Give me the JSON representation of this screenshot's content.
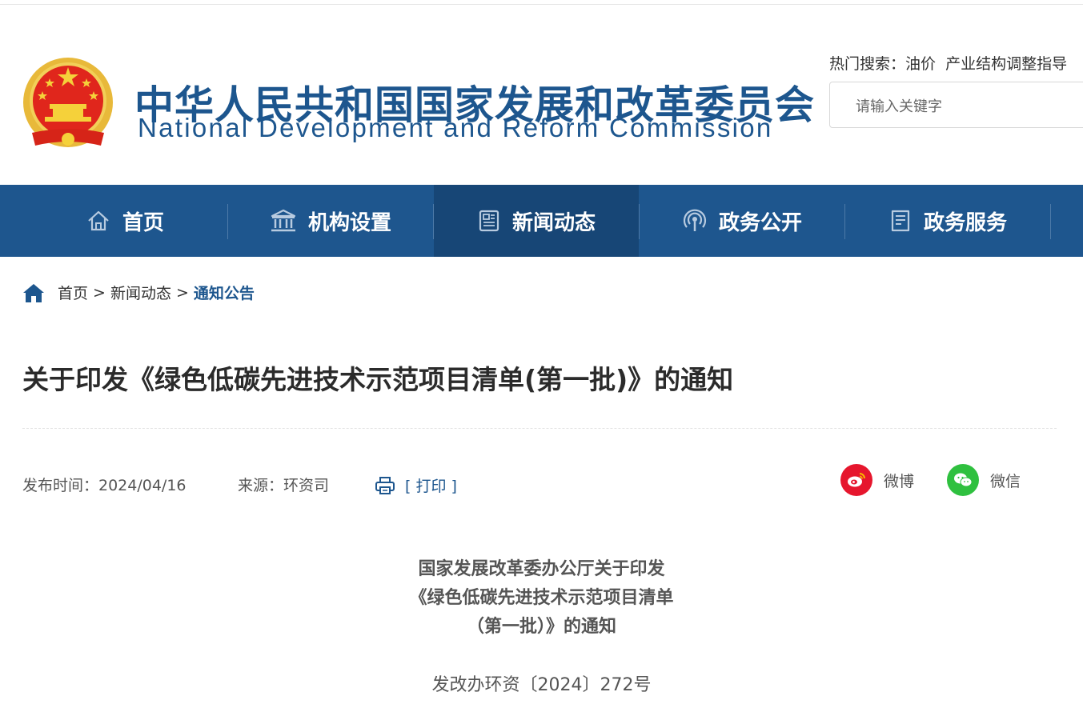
{
  "header": {
    "logo_cn": "中华人民共和国国家发展和改革委员会",
    "logo_en": "National Development and Reform Commission",
    "hot_search_label": "热门搜索：",
    "hot_search_terms": [
      "油价",
      "产业结构调整指导"
    ],
    "search_placeholder": "请输入关键字"
  },
  "nav": {
    "items": [
      {
        "label": "首页",
        "icon": "home-icon"
      },
      {
        "label": "机构设置",
        "icon": "institution-icon"
      },
      {
        "label": "新闻动态",
        "icon": "news-icon"
      },
      {
        "label": "政务公开",
        "icon": "broadcast-icon"
      },
      {
        "label": "政务服务",
        "icon": "document-icon"
      }
    ],
    "active": "新闻动态"
  },
  "breadcrumb": {
    "items": [
      "首页",
      "新闻动态",
      "通知公告"
    ],
    "separator": ">"
  },
  "article": {
    "title": "关于印发《绿色低碳先进技术示范项目清单(第一批)》的通知",
    "publish_time": "发布时间：2024/04/16",
    "source": "来源：环资司",
    "print_label": "[ 打印 ]",
    "share": {
      "weibo": "微博",
      "wechat": "微信"
    },
    "heading_lines": [
      "国家发展改革委办公厅关于印发",
      "《绿色低碳先进技术示范项目清单",
      "（第一批）》的通知"
    ],
    "doc_number": "发改办环资〔2024〕272号"
  },
  "colors": {
    "brand_blue": "#1d568e",
    "nav_active": "#174676",
    "weibo_red": "#e6162d",
    "wechat_green": "#2fc03f"
  }
}
